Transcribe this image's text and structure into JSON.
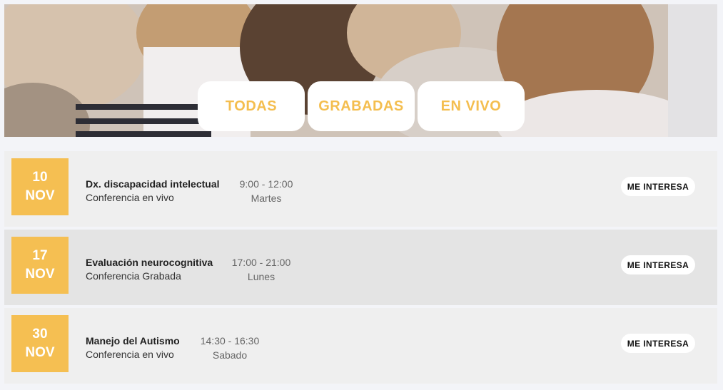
{
  "filters": {
    "all_label": "TODAS",
    "recorded_label": "GRABADAS",
    "live_label": "EN VIVO"
  },
  "colors": {
    "accent": "#f5bf52",
    "tab_text": "#f4be4f",
    "row_bg": "#efefef",
    "row_bg_alt": "#e4e4e4"
  },
  "events": [
    {
      "day": "10",
      "month": "NOV",
      "title": "Dx. discapacidad intelectual",
      "type": "Conferencia en vivo",
      "time": "9:00 - 12:00",
      "weekday": "Martes",
      "button": "ME INTERESA"
    },
    {
      "day": "17",
      "month": "NOV",
      "title": "Evaluación neurocognitiva",
      "type": "Conferencia Grabada",
      "time": "17:00 - 21:00",
      "weekday": "Lunes",
      "button": "ME INTERESA"
    },
    {
      "day": "30",
      "month": "NOV",
      "title": "Manejo del Autismo",
      "type": "Conferencia en vivo",
      "time": "14:30 - 16:30",
      "weekday": "Sabado",
      "button": "ME INTERESA"
    }
  ]
}
